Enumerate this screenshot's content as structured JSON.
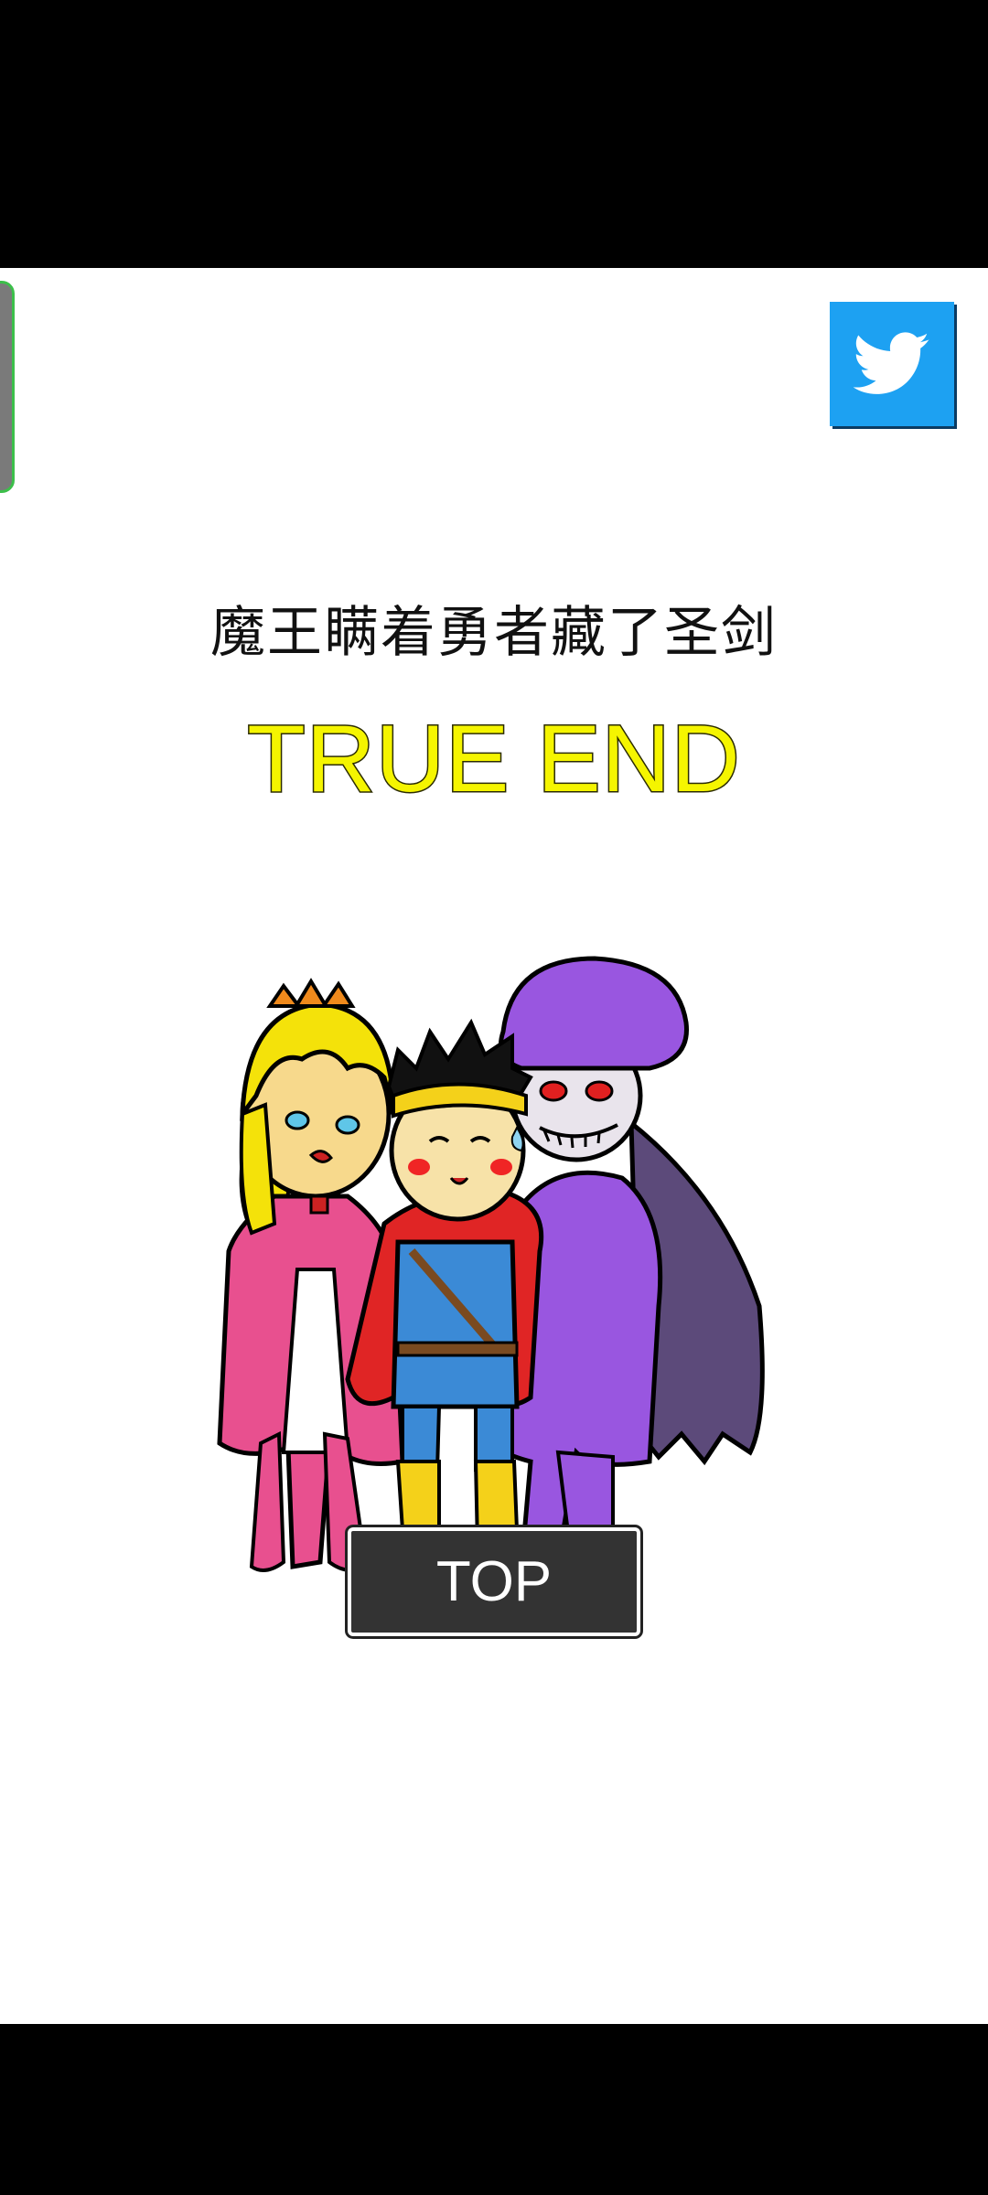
{
  "screen": {
    "subtitle": "魔王瞒着勇者藏了圣剑",
    "ending_label": "TRUE END",
    "top_button_label": "TOP"
  },
  "icons": {
    "share": "twitter-bird-icon"
  },
  "colors": {
    "ending_label": "#f5f500",
    "twitter_blue": "#1da1f2",
    "button_bg": "#333333"
  },
  "illustration": {
    "characters": [
      "princess",
      "hero",
      "demon-lord"
    ]
  }
}
